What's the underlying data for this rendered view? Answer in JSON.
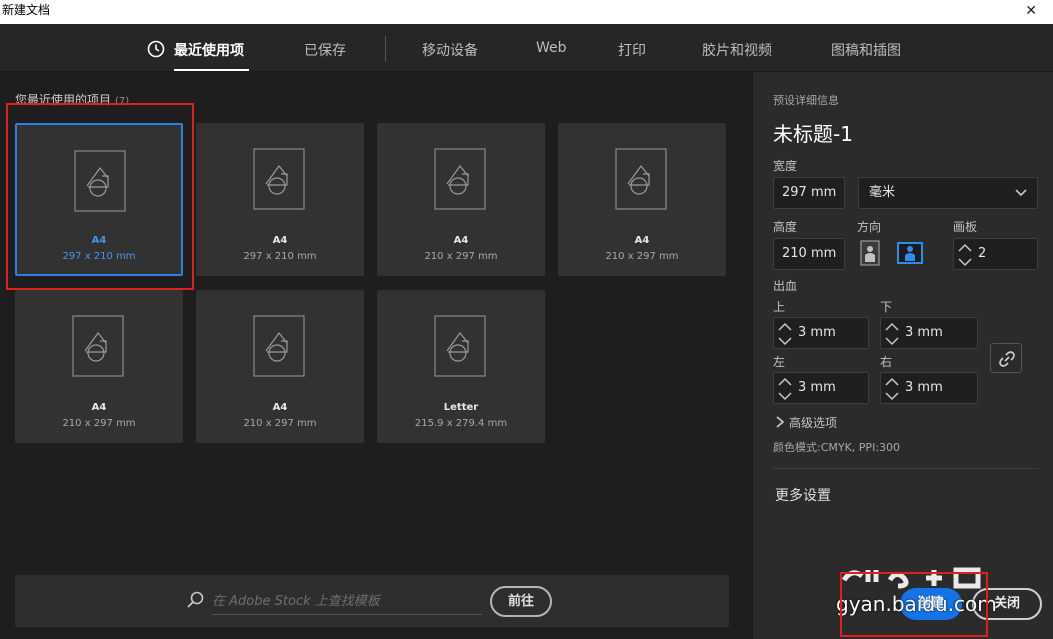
{
  "window": {
    "title": "新建文档",
    "close_glyph": "✕"
  },
  "tabs": [
    {
      "label": "最近使用项",
      "active": true,
      "icon": "clock-icon"
    },
    {
      "label": "已保存"
    },
    {
      "label": "移动设备"
    },
    {
      "label": "Web"
    },
    {
      "label": "打印"
    },
    {
      "label": "胶片和视频"
    },
    {
      "label": "图稿和插图"
    }
  ],
  "recent": {
    "title": "您最近使用的项目",
    "count": "(7)",
    "items": [
      {
        "name": "A4",
        "size": "297 x 210 mm",
        "selected": true
      },
      {
        "name": "A4",
        "size": "297 x 210 mm"
      },
      {
        "name": "A4",
        "size": "210 x 297 mm"
      },
      {
        "name": "A4",
        "size": "210 x 297 mm"
      },
      {
        "name": "A4",
        "size": "210 x 297 mm"
      },
      {
        "name": "A4",
        "size": "210 x 297 mm"
      },
      {
        "name": "Letter",
        "size": "215.9 x 279.4 mm"
      }
    ]
  },
  "stock": {
    "placeholder": "在 Adobe Stock 上查找模板",
    "go_label": "前往"
  },
  "preset": {
    "section_label": "预设详细信息",
    "doc_name": "未标题-1",
    "width_label": "宽度",
    "width_value": "297 mm",
    "unit_value": "毫米",
    "height_label": "高度",
    "height_value": "210 mm",
    "orientation_label": "方向",
    "artboards_label": "画板",
    "artboards_value": "2",
    "bleed_label": "出血",
    "bleed_top_label": "上",
    "bleed_top_value": "3 mm",
    "bleed_bottom_label": "下",
    "bleed_bottom_value": "3 mm",
    "bleed_left_label": "左",
    "bleed_left_value": "3 mm",
    "bleed_right_label": "右",
    "bleed_right_value": "3 mm",
    "advanced_label": "高级选项",
    "color_mode": "颜色模式:CMYK, PPI:300",
    "more_settings": "更多设置"
  },
  "actions": {
    "create_label": "创建",
    "close_label": "关闭"
  },
  "watermark": {
    "text": "gyan.baidu.com"
  },
  "colors": {
    "accent": "#1473e6",
    "selected_border": "#2d7fe0",
    "annotation": "#e02020"
  }
}
